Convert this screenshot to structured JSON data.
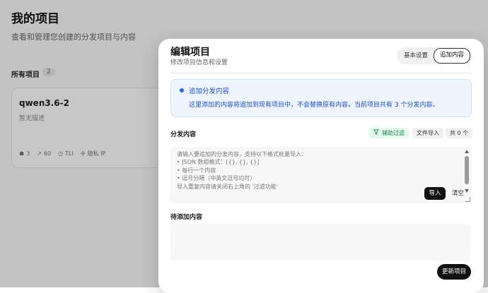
{
  "background": {
    "page_title": "我的项目",
    "page_subtitle": "查看和管理您创建的分发项目与内容",
    "all_projects_label": "所有项目",
    "all_projects_count": "2",
    "card": {
      "title": "qwen3.6-2",
      "description": "暂无描述",
      "stats": [
        "3",
        "60",
        "TLI",
        "隐私 IP"
      ]
    }
  },
  "modal": {
    "title": "编辑项目",
    "subtitle": "修改项目信息和设置",
    "tabs": [
      {
        "label": "基本设置",
        "active": false
      },
      {
        "label": "追加内容",
        "active": true
      }
    ],
    "info": {
      "title": "追加分发内容",
      "text": "这里添加的内容将追加到现有项目中，不会替换原有内容。当前项目共有 3 个分发内容。"
    },
    "content_section": {
      "label": "分发内容",
      "filter_button": "辅助过滤",
      "file_import_button": "文件导入",
      "count": "共 0 个",
      "placeholder": "请输入要追加的分发内容，支持以下格式批量导入：\n• JSON 数组格式：[{}, {}, {}]\n• 每行一个内容\n• 逗号分隔（中英文逗号均可）\n导入重复内容请关闭右上角的 '过滤功能'",
      "import_button": "导入",
      "clear_button": "清空"
    },
    "pending_section": {
      "label": "待添加内容"
    },
    "update_button": "更新项目"
  },
  "colors": {
    "accent_blue": "#1d4ed8",
    "info_bg": "#eef5ff",
    "filter_green": "#1f8a4c",
    "primary_button": "#111111"
  }
}
